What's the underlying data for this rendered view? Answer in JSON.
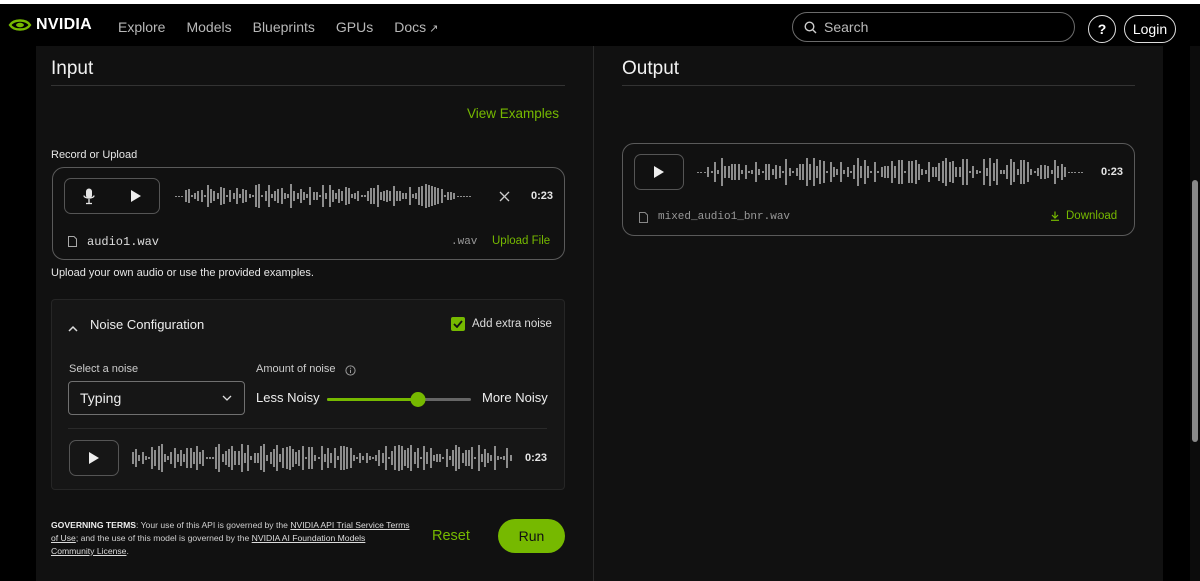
{
  "nav": {
    "brand": "NVIDIA",
    "links": [
      "Explore",
      "Models",
      "Blueprints",
      "GPUs",
      "Docs"
    ],
    "search_placeholder": "Search",
    "help_label": "?",
    "login_label": "Login"
  },
  "input": {
    "title": "Input",
    "view_examples": "View Examples",
    "record_label": "Record or Upload",
    "duration": "0:23",
    "file_name": "audio1.wav",
    "file_ext": ".wav",
    "upload_label": "Upload File",
    "helper_text": "Upload your own audio or use the provided examples."
  },
  "noise": {
    "title": "Noise Configuration",
    "add_extra_noise_label": "Add extra noise",
    "add_extra_noise_checked": true,
    "select_label": "Select a noise",
    "selected_noise": "Typing",
    "amount_label": "Amount of noise",
    "less_label": "Less Noisy",
    "more_label": "More Noisy",
    "amount_fraction": 0.63,
    "duration": "0:23"
  },
  "footer": {
    "terms_heading": "GOVERNING TERMS",
    "terms_part1": ": Your use of this API is governed by the ",
    "terms_link1": "NVIDIA API Trial Service Terms of Use",
    "terms_part2": "; and the use of this model is governed by the ",
    "terms_link2": "NVIDIA AI Foundation Models Community License",
    "terms_part3": ".",
    "reset_label": "Reset",
    "run_label": "Run"
  },
  "output": {
    "title": "Output",
    "duration": "0:23",
    "file_name": "mixed_audio1_bnr.wav",
    "download_label": "Download"
  },
  "colors": {
    "accent": "#76b900",
    "background": "#111111"
  }
}
